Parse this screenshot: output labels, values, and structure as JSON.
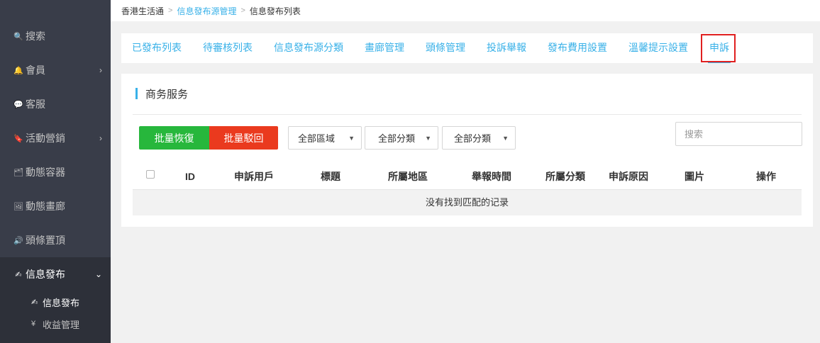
{
  "sidebar": {
    "items": [
      {
        "icon": "search-icon",
        "glyph": "🔍",
        "label": "搜索"
      },
      {
        "icon": "bell-icon",
        "glyph": "🔔",
        "label": "會員"
      },
      {
        "icon": "chat-icon",
        "glyph": "💬",
        "label": "客服"
      },
      {
        "icon": "bookmark-icon",
        "glyph": "🔖",
        "label": "活動營銷"
      },
      {
        "icon": "container-icon",
        "glyph": "🗂",
        "label": "動態容器"
      },
      {
        "icon": "image-icon",
        "glyph": "🖼",
        "label": "動態畫廊"
      },
      {
        "icon": "speaker-icon",
        "glyph": "🔊",
        "label": "頭條置頂"
      },
      {
        "icon": "edit-check-icon",
        "glyph": "✍",
        "label": "信息發布"
      }
    ],
    "sub_items": [
      {
        "icon": "edit-check-icon",
        "glyph": "✍",
        "label": "信息發布"
      },
      {
        "icon": "yen-icon",
        "glyph": "¥",
        "label": "收益管理"
      }
    ],
    "arrow_right": "›",
    "arrow_down": "⌄"
  },
  "breadcrumb": {
    "home": "香港生活通",
    "level2": "信息發布源管理",
    "level3": "信息發布列表",
    "separator": ">"
  },
  "tabs": [
    "已發布列表",
    "待審核列表",
    "信息發布源分類",
    "畫廊管理",
    "頭條管理",
    "投訴舉報",
    "發布費用設置",
    "溫馨提示設置",
    "申訴"
  ],
  "panel": {
    "title": "商务服务",
    "btn_restore": "批量恢復",
    "btn_reject": "批量駁回",
    "filters": [
      "全部區域",
      "全部分類",
      "全部分類"
    ],
    "search_placeholder": "搜索",
    "columns": [
      "ID",
      "申訴用戶",
      "標題",
      "所屬地區",
      "舉報時間",
      "所屬分類",
      "申訴原因",
      "圖片",
      "操作"
    ],
    "empty_text": "没有找到匹配的记录"
  },
  "colors": {
    "accent": "#39b1e8",
    "sidebar_bg": "#393d49",
    "green": "#27b73c",
    "red": "#ea3a1e",
    "highlight": "#e02020"
  }
}
